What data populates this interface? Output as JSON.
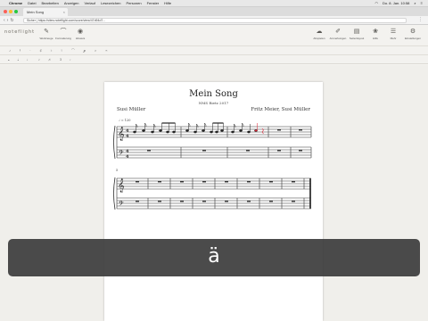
{
  "menubar": {
    "items": [
      "Chrome",
      "Datei",
      "Bearbeiten",
      "Anzeigen",
      "Verlauf",
      "Lesezeichen",
      "Personen",
      "Fenster",
      "Hilfe"
    ],
    "clock": "Do. 8. Jan. 10:58"
  },
  "browser": {
    "tab_title": "Mein Song",
    "url": "Sicher | https://sites.noteflight.com/score/view/47d94d7..."
  },
  "app": {
    "logo": "noteflight",
    "left_tools": [
      "Werkzeuge",
      "Formatierung",
      "Hinweis"
    ],
    "right_tools": [
      "Abspielen",
      "Anmerkungen",
      "Seitenlayout",
      "Hilfe",
      "Mehr",
      "Einstellungen"
    ]
  },
  "score": {
    "title": "Mein Song",
    "subtitle": "NMS Rietz 2017",
    "lyricist": "Susi Müller",
    "composer": "Fritz Meier, Susi Müller",
    "tempo": "♩ = 120",
    "second_system_measure": "5"
  },
  "overlay": {
    "character": "ä"
  }
}
